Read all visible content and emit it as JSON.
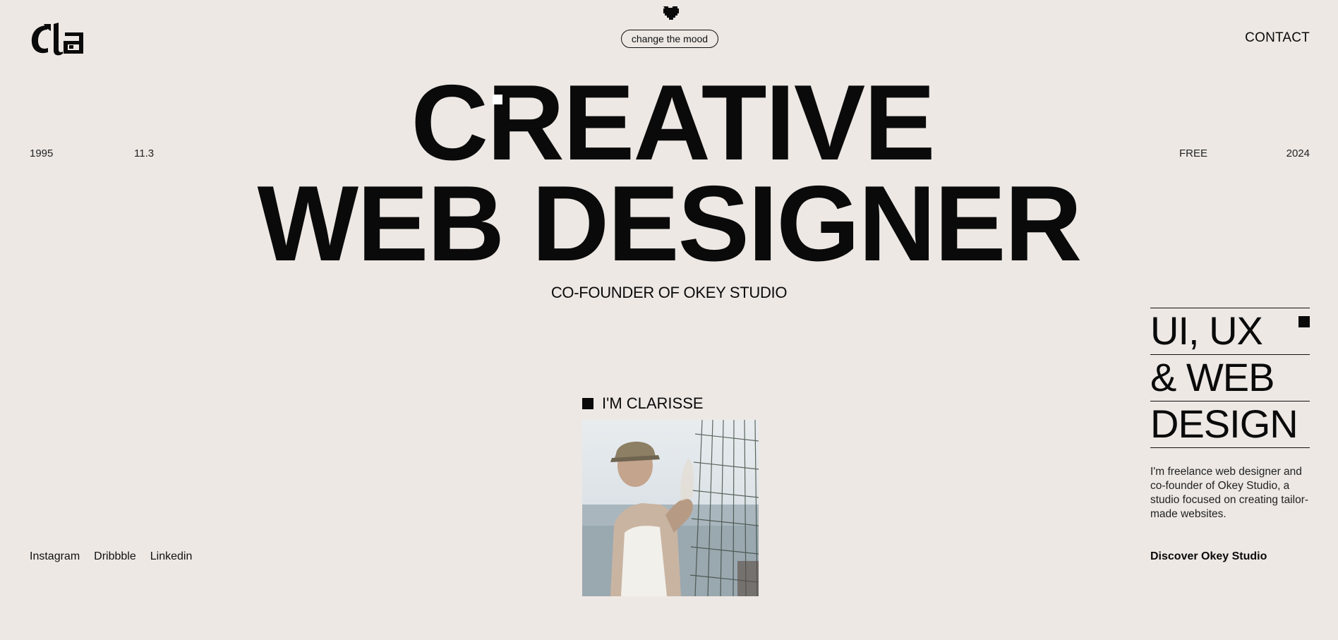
{
  "header": {
    "logo_text": "cla",
    "mood_button": "change the mood",
    "contact": "CONTACT"
  },
  "meta": {
    "left_year": "1995",
    "left_date": "11.3",
    "right_status": "FREE",
    "right_year": "2024"
  },
  "hero": {
    "line1": "CREATIVE",
    "line2": "WEB DESIGNER",
    "subtitle": "CO-FOUNDER OF OKEY STUDIO"
  },
  "intro": {
    "label": "I'M CLARISSE"
  },
  "social": {
    "instagram": "Instagram",
    "dribbble": "Dribbble",
    "linkedin": "Linkedin"
  },
  "services": {
    "items": [
      "UI, UX",
      "& WEB",
      "DESIGN"
    ],
    "description": "I'm freelance web designer and co-founder of Okey Studio, a studio focused on creating tailor-made websites.",
    "discover": "Discover Okey Studio"
  },
  "colors": {
    "background": "#ede8e4",
    "text": "#0a0a0a"
  }
}
